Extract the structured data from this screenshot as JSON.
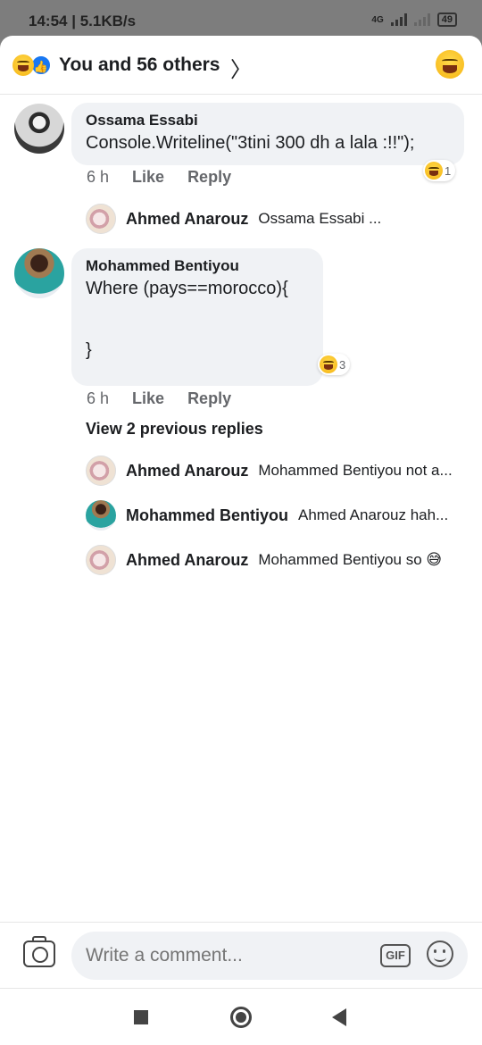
{
  "status": {
    "time": "14:54",
    "speed": "5.1KB/s",
    "battery": "49",
    "network": "4G"
  },
  "reactions": {
    "summary": "You and 56 others",
    "icons": [
      "haha-icon",
      "like-icon"
    ]
  },
  "comments": [
    {
      "author": "Ossama Essabi",
      "text": "Console.Writeline(\"3tini 300 dh a lala :!!\");",
      "time": "6 h",
      "like": "Like",
      "reply": "Reply",
      "reaction_count": "1"
    },
    {
      "author": "Mohammed Bentiyou",
      "text": "Where (pays==morocco){\n\n\n}",
      "time": "6 h",
      "like": "Like",
      "reply": "Reply",
      "reaction_count": "3"
    }
  ],
  "reply_preview_1": {
    "author": "Ahmed Anarouz",
    "text": "Ossama Essabi ..."
  },
  "view_previous": "View 2 previous replies",
  "replies": [
    {
      "author": "Ahmed Anarouz",
      "text": "Mohammed Bentiyou not a..."
    },
    {
      "author": "Mohammed Bentiyou",
      "text": "Ahmed Anarouz hah..."
    },
    {
      "author": "Ahmed Anarouz",
      "text": "Mohammed Bentiyou so 😅"
    }
  ],
  "composer": {
    "placeholder": "Write a comment...",
    "gif": "GIF"
  }
}
